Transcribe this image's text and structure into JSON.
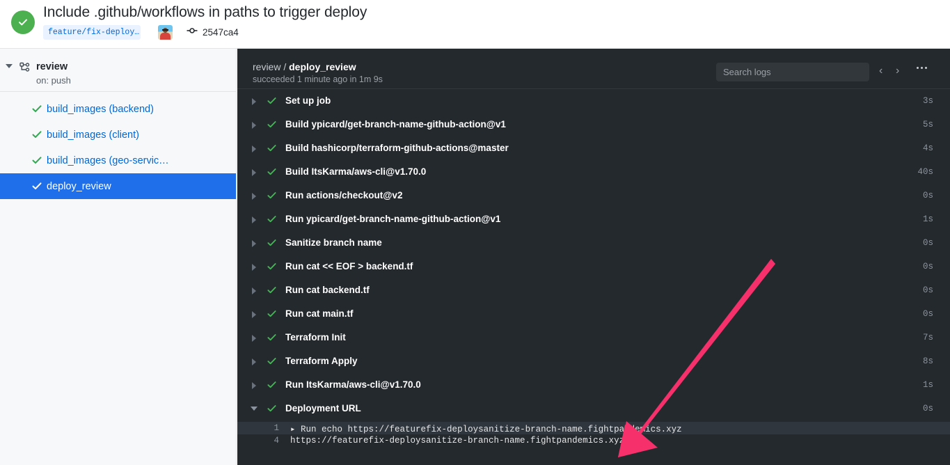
{
  "header": {
    "status_icon": "check-circle-icon",
    "status_color": "#4caf50",
    "title": "Include .github/workflows in paths to trigger deploy",
    "branch": "feature/fix-deploy…",
    "avatar": "user-avatar",
    "commit_icon": "commit-icon",
    "commit_sha": "2547ca4"
  },
  "sidebar": {
    "workflow": {
      "caret": "chevron-down-icon",
      "icon": "workflow-icon",
      "name": "review",
      "trigger": "on: push"
    },
    "jobs": [
      {
        "label": "build_images (backend)",
        "status": "success",
        "selected": false
      },
      {
        "label": "build_images (client)",
        "status": "success",
        "selected": false
      },
      {
        "label": "build_images (geo-servic…",
        "status": "success",
        "selected": false
      },
      {
        "label": "deploy_review",
        "status": "success",
        "selected": true
      }
    ],
    "selected_color": "#1f6feb"
  },
  "main": {
    "breadcrumb_prefix": "review / ",
    "breadcrumb_job": "deploy_review",
    "subtitle": "succeeded 1 minute ago in 1m 9s",
    "search": {
      "placeholder": "Search logs",
      "value": ""
    },
    "nav_prev": "‹",
    "nav_next": "›",
    "kebab": "more-options-icon",
    "steps": [
      {
        "name": "Set up job",
        "duration": "3s",
        "status": "success",
        "expanded": false
      },
      {
        "name": "Build ypicard/get-branch-name-github-action@v1",
        "duration": "5s",
        "status": "success",
        "expanded": false
      },
      {
        "name": "Build hashicorp/terraform-github-actions@master",
        "duration": "4s",
        "status": "success",
        "expanded": false
      },
      {
        "name": "Build ItsKarma/aws-cli@v1.70.0",
        "duration": "40s",
        "status": "success",
        "expanded": false
      },
      {
        "name": "Run actions/checkout@v2",
        "duration": "0s",
        "status": "success",
        "expanded": false
      },
      {
        "name": "Run ypicard/get-branch-name-github-action@v1",
        "duration": "1s",
        "status": "success",
        "expanded": false
      },
      {
        "name": "Sanitize branch name",
        "duration": "0s",
        "status": "success",
        "expanded": false
      },
      {
        "name": "Run cat << EOF > backend.tf",
        "duration": "0s",
        "status": "success",
        "expanded": false
      },
      {
        "name": "Run cat backend.tf",
        "duration": "0s",
        "status": "success",
        "expanded": false
      },
      {
        "name": "Run cat main.tf",
        "duration": "0s",
        "status": "success",
        "expanded": false
      },
      {
        "name": "Terraform Init",
        "duration": "7s",
        "status": "success",
        "expanded": false
      },
      {
        "name": "Terraform Apply",
        "duration": "8s",
        "status": "success",
        "expanded": false
      },
      {
        "name": "Run ItsKarma/aws-cli@v1.70.0",
        "duration": "1s",
        "status": "success",
        "expanded": false
      },
      {
        "name": "Deployment URL",
        "duration": "0s",
        "status": "success",
        "expanded": true
      }
    ],
    "log_lines": [
      {
        "num": "1",
        "text": "▸ Run echo https://featurefix-deploysanitize-branch-name.fightpandemics.xyz",
        "highlight": true
      },
      {
        "num": "4",
        "text": "https://featurefix-deploysanitize-branch-name.fightpandemics.xyz",
        "highlight": false
      }
    ]
  },
  "annotation": {
    "arrow_color": "#f6306b",
    "name": "pink-arrow-annotation"
  }
}
